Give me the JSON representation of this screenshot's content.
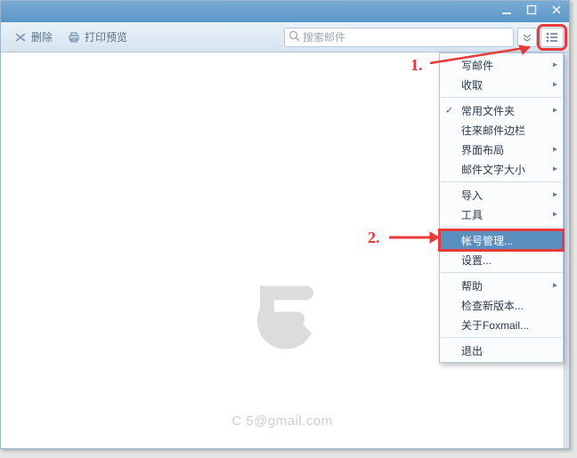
{
  "toolbar": {
    "delete_label": "删除",
    "print_preview_label": "打印预览"
  },
  "search": {
    "placeholder": "搜索邮件"
  },
  "menu": {
    "items": [
      {
        "label": "写邮件",
        "submenu": true
      },
      {
        "label": "收取",
        "submenu": true
      },
      {
        "sep": true
      },
      {
        "label": "常用文件夹",
        "submenu": true,
        "checked": true
      },
      {
        "label": "往来邮件边栏"
      },
      {
        "label": "界面布局",
        "submenu": true
      },
      {
        "label": "邮件文字大小",
        "submenu": true
      },
      {
        "sep": true
      },
      {
        "label": "导入",
        "submenu": true
      },
      {
        "label": "工具",
        "submenu": true
      },
      {
        "sep": true
      },
      {
        "label": "帐号管理...",
        "selected": true,
        "hot": true
      },
      {
        "label": "设置..."
      },
      {
        "sep": true
      },
      {
        "label": "帮助",
        "submenu": true
      },
      {
        "label": "检查新版本..."
      },
      {
        "label": "关于Foxmail..."
      },
      {
        "sep": true
      },
      {
        "label": "退出"
      }
    ]
  },
  "footer": {
    "masked_email": "C                        5@gmail.com"
  },
  "annotations": {
    "step1": "1.",
    "step2": "2."
  }
}
